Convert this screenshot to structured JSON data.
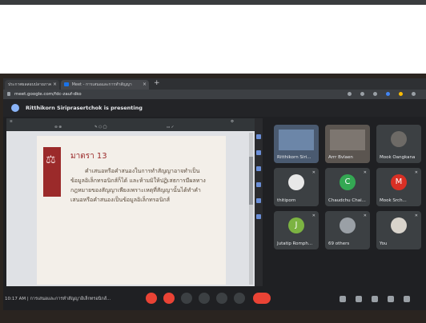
{
  "browser": {
    "tabs": [
      {
        "label": "ประกาศผลสอบปลายภาค"
      },
      {
        "label": "Meet - การเสนอและการทำสัญญา"
      }
    ],
    "tab_close": "×",
    "new_tab": "+",
    "url": "meet.google.com/fdc-zauf-dko"
  },
  "banner": {
    "presenter_text": "Ritthikorn Siriprasertchok is presenting"
  },
  "slide": {
    "title": "มาตรา 13",
    "body": "คำเสนอหรือคำสนองในการทำสัญญาอาจทำเป็นข้อมูลอิเล็กทรอนิกส์ก็ได้ และห้ามมิให้ปฏิเสธการมีผลทางกฎหมายของสัญญาเพียงเพราะเหตุที่สัญญานั้นได้ทำคำเสนอหรือคำสนองเป็นข้อมูลอิเล็กทรอนิกส์"
  },
  "participants": [
    {
      "name": "Ritthikorn Siri...",
      "kind": "video"
    },
    {
      "name": "Arrr Bvlaen",
      "kind": "video"
    },
    {
      "name": "Mook Oangkana",
      "kind": "photo"
    },
    {
      "name": "thitiporn",
      "kind": "photo"
    },
    {
      "name": "Chaudchu Chai...",
      "initial": "C",
      "color": "#34a853"
    },
    {
      "name": "Mook Srch...",
      "initial": "M",
      "color": "#d93025"
    },
    {
      "name": "Jutatip Romph...",
      "initial": "J",
      "color": "#7cb342"
    },
    {
      "name": "69 others",
      "kind": "others"
    },
    {
      "name": "You",
      "kind": "photo"
    }
  ],
  "bottom": {
    "meeting_info": "10:17 AM | การเสนอและการทำสัญญาอิเล็กทรอนิกส์..."
  },
  "colors": {
    "end_call": "#ea4335",
    "slide_accent": "#9b2a2a",
    "background": "#1f2023"
  }
}
